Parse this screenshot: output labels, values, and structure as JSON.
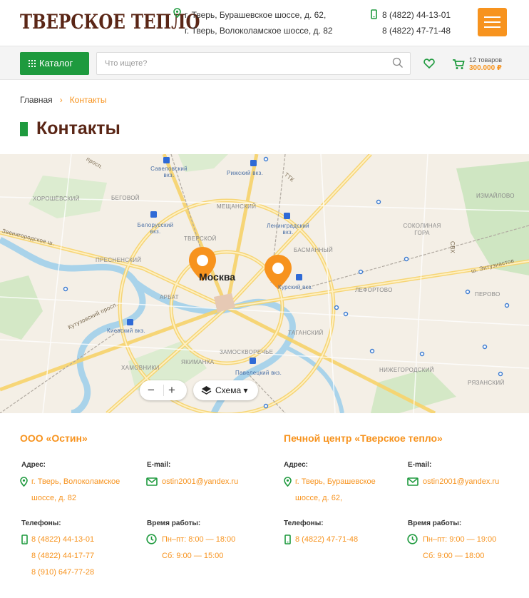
{
  "header": {
    "logo_text": "ТВЕРСКОЕ ТЕПЛО",
    "addresses": [
      "г. Тверь, Бурашевское шоссе, д. 62,",
      "г. Тверь, Волоколамское шоссе, д. 82"
    ],
    "phones": [
      "8 (4822) 44-13-01",
      "8 (4822) 47-71-48"
    ],
    "accent_color": "#f7931e",
    "brand_color": "#5a2616",
    "green_color": "#1e9a3e"
  },
  "toolbar": {
    "catalog_label": "Каталог",
    "search_placeholder": "Что ищете?",
    "cart_count": "12 товаров",
    "cart_sum": "300.000 ₽"
  },
  "breadcrumb": {
    "home": "Главная",
    "separator": "›",
    "current": "Контакты"
  },
  "page_title": "Контакты",
  "map": {
    "city_label": "Москва",
    "labels": {
      "savyolovsky": "Савеловский вкз.",
      "rizhsky": "Рижский вкз.",
      "khoroshyovsky": "ХОРОШЁВСКИЙ",
      "begovoy": "БЕГОВОЙ",
      "meshchansky": "МЕЩАНСКИЙ",
      "belorussky": "Белорусский вкз.",
      "leningradsky": "Ленинградский вкз.",
      "tverskoy": "ТВЕРСКОЙ",
      "basmanny": "БАСМАННЫЙ",
      "presnensky": "ПРЕСНЕНСКИЙ",
      "kursky": "Курский вкз.",
      "arbat": "АРБАТ",
      "lefortovo": "ЛЕФОРТОВО",
      "kievsky": "Киевский вкз.",
      "tagansky": "ТАГАНСКИЙ",
      "zamoskvorechye": "ЗАМОСКВОРЕЧЬЕ",
      "khamovniki": "ХАМОВНИКИ",
      "yakimanka": "ЯКИМАНКА",
      "paveletsky": "Павелецкий вкз.",
      "nizhegorodsky": "НИЖЕГОРОДСКИЙ",
      "ryazansky": "РЯЗАНСКИЙ",
      "izmaylovo": "ИЗМАЙЛОВО",
      "sokolinaya": "СОКОЛИНАЯ ГОРА",
      "perovo": "ПЕРОВО",
      "entuziastov": "ш. Энтузиастов",
      "zvenigorodskoe": "Звенигородское ш.",
      "kutuzovsky": "Кутузовский просп.",
      "ttk": "ТТК",
      "svkh": "СВХ",
      "prosp": "просп."
    },
    "zoom_minus": "−",
    "zoom_plus": "+",
    "layer_label": "Схема ▾"
  },
  "contacts": [
    {
      "name": "ООО «Остин»",
      "address_label": "Адрес:",
      "address": [
        "г. Тверь, Волоколамское",
        "шоссе, д. 82"
      ],
      "email_label": "E-mail:",
      "email": "ostin2001@yandex.ru",
      "phones_label": "Телефоны:",
      "phones": [
        "8 (4822) 44-13-01",
        "8 (4822) 44-17-77",
        "8 (910) 647-77-28"
      ],
      "hours_label": "Время работы:",
      "hours": [
        "Пн–пт: 8:00 — 18:00",
        "Сб: 9:00 — 15:00"
      ]
    },
    {
      "name": "Печной центр «Тверское тепло»",
      "address_label": "Адрес:",
      "address": [
        "г. Тверь, Бурашевское",
        "шоссе, д. 62,"
      ],
      "email_label": "E-mail:",
      "email": "ostin2001@yandex.ru",
      "phones_label": "Телефоны:",
      "phones": [
        "8 (4822) 47-71-48"
      ],
      "hours_label": "Время работы:",
      "hours": [
        "Пн–пт: 9:00 — 19:00",
        "Сб: 9:00 — 18:00"
      ]
    }
  ]
}
